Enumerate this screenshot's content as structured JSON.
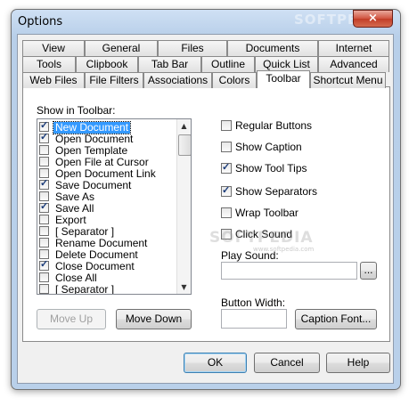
{
  "window": {
    "title": "Options",
    "close_glyph": "×"
  },
  "watermark": {
    "brand": "SOFTPEDIA",
    "url": "www.softpedia.com"
  },
  "tabs": {
    "row1": [
      "View",
      "General",
      "Files",
      "Documents",
      "Internet"
    ],
    "row2": [
      "Tools",
      "Clipbook",
      "Tab Bar",
      "Outline",
      "Quick List",
      "Advanced"
    ],
    "row3": [
      "Web Files",
      "File Filters",
      "Associations",
      "Colors",
      "Toolbar",
      "Shortcut Menu"
    ],
    "active": "Toolbar"
  },
  "toolbar_list": {
    "label": "Show in Toolbar:",
    "items": [
      {
        "text": "New Document",
        "checked": true,
        "selected": true
      },
      {
        "text": "Open Document",
        "checked": true,
        "selected": false
      },
      {
        "text": "Open Template",
        "checked": false,
        "selected": false
      },
      {
        "text": "Open File at Cursor",
        "checked": false,
        "selected": false
      },
      {
        "text": "Open Document Link",
        "checked": false,
        "selected": false
      },
      {
        "text": "Save Document",
        "checked": true,
        "selected": false
      },
      {
        "text": "Save As",
        "checked": false,
        "selected": false
      },
      {
        "text": "Save All",
        "checked": true,
        "selected": false
      },
      {
        "text": "Export",
        "checked": false,
        "selected": false
      },
      {
        "text": "[ Separator ]",
        "checked": false,
        "selected": false
      },
      {
        "text": "Rename Document",
        "checked": false,
        "selected": false
      },
      {
        "text": "Delete Document",
        "checked": false,
        "selected": false
      },
      {
        "text": "Close Document",
        "checked": true,
        "selected": false
      },
      {
        "text": "Close All",
        "checked": false,
        "selected": false
      },
      {
        "text": "[ Separator ]",
        "checked": false,
        "selected": false
      }
    ]
  },
  "buttons": {
    "move_up": "Move Up",
    "move_down": "Move Down",
    "caption_font": "Caption Font...",
    "browse": "...",
    "ok": "OK",
    "cancel": "Cancel",
    "help": "Help"
  },
  "options": [
    {
      "label": "Regular Buttons",
      "checked": false
    },
    {
      "label": "Show Caption",
      "checked": false
    },
    {
      "label": "Show Tool Tips",
      "checked": true
    },
    {
      "label": "Show Separators",
      "checked": true
    },
    {
      "label": "Wrap Toolbar",
      "checked": false
    },
    {
      "label": "Click Sound",
      "checked": false
    }
  ],
  "play_sound": {
    "label": "Play Sound:",
    "value": ""
  },
  "button_width": {
    "label": "Button Width:",
    "value": ""
  },
  "colors": {
    "selection": "#3399ff",
    "dialog_bg": "#f0f0f0",
    "title_bar": "#b9d0ea",
    "close_button": "#c23d27"
  }
}
